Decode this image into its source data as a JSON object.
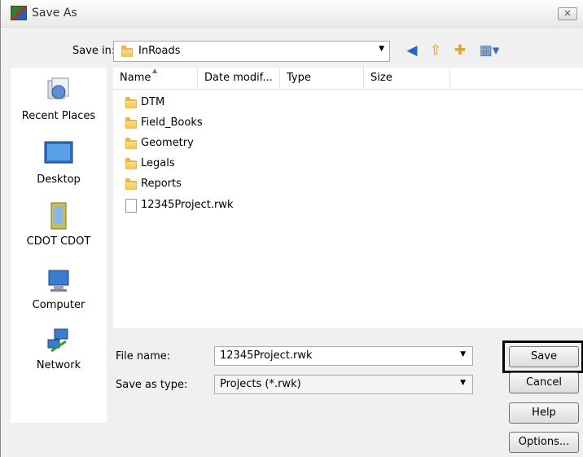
{
  "window": {
    "title": "Save As",
    "close_glyph": "✕"
  },
  "toolbar": {
    "save_in_label": "Save in:",
    "save_in_value": "InRoads",
    "icons": [
      "back-icon",
      "up-folder-icon",
      "new-folder-icon",
      "views-menu-icon"
    ]
  },
  "places": [
    {
      "label": "Recent Places",
      "icon": "recent-places-icon"
    },
    {
      "label": "Desktop",
      "icon": "desktop-icon"
    },
    {
      "label": "CDOT CDOT",
      "icon": "user-folder-icon"
    },
    {
      "label": "Computer",
      "icon": "computer-icon"
    },
    {
      "label": "Network",
      "icon": "network-icon"
    }
  ],
  "columns": [
    "Name",
    "Date modif...",
    "Type",
    "Size"
  ],
  "files": [
    {
      "name": "DTM",
      "kind": "folder"
    },
    {
      "name": "Field_Books",
      "kind": "folder"
    },
    {
      "name": "Geometry",
      "kind": "folder"
    },
    {
      "name": "Legals",
      "kind": "folder"
    },
    {
      "name": "Reports",
      "kind": "folder"
    },
    {
      "name": "12345Project.rwk",
      "kind": "file"
    }
  ],
  "form": {
    "file_name_label": "File name:",
    "file_name_value": "12345Project.rwk",
    "save_type_label": "Save as type:",
    "save_type_value": "Projects (*.rwk)"
  },
  "buttons": {
    "save": "Save",
    "cancel": "Cancel",
    "help": "Help",
    "options": "Options..."
  },
  "colors": {
    "folder": "#e8b64a",
    "dialog_bg": "#f0f0f0",
    "focus_outline": "#000000"
  }
}
